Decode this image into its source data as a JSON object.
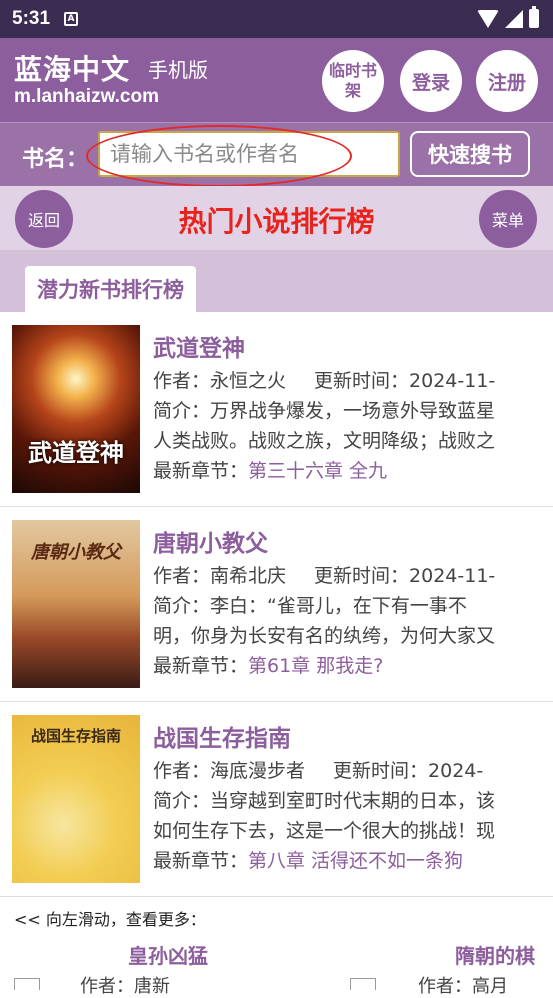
{
  "status_bar": {
    "time": "5:31",
    "notification_icon": "A"
  },
  "header": {
    "site_name": "蓝海中文",
    "site_sub": "手机版",
    "site_url": "m.lanhaizw.com",
    "buttons": {
      "bookshelf": "临时书架",
      "login": "登录",
      "register": "注册"
    }
  },
  "search": {
    "label": "书名：",
    "placeholder": "请输入书名或作者名",
    "button": "快速搜书"
  },
  "titlebar": {
    "back": "返回",
    "title": "热门小说排行榜",
    "menu": "菜单"
  },
  "tab": {
    "label": "潜力新书排行榜"
  },
  "books": [
    {
      "title": "武道登神",
      "cover_title": "武道登神",
      "author_label": "作者：",
      "author": "永恒之火",
      "update_label": "更新时间：",
      "update": "2024-11-",
      "intro_label": "简介：",
      "intro_1": "万界战争爆发，一场意外导致蓝星",
      "intro_2": "人类战败。战败之族，文明降级；战败之",
      "chapter_label": "最新章节：",
      "chapter": "第三十六章 全九"
    },
    {
      "title": "唐朝小教父",
      "cover_title": "唐朝小教父",
      "author_label": "作者：",
      "author": "南希北庆",
      "update_label": "更新时间：",
      "update": "2024-11-",
      "intro_label": "简介：",
      "intro_1": "李白：“雀哥儿，在下有一事不",
      "intro_2": "明，你身为长安有名的纨绔，为何大家又",
      "chapter_label": "最新章节：",
      "chapter": "第61章 那我走?"
    },
    {
      "title": "战国生存指南",
      "cover_title": "战国生存指南",
      "author_label": "作者：",
      "author": "海底漫步者",
      "update_label": "更新时间：",
      "update": "2024-",
      "intro_label": "简介：",
      "intro_1": "当穿越到室町时代末期的日本，该",
      "intro_2": "如何生存下去，这是一个很大的挑战！现",
      "chapter_label": "最新章节：",
      "chapter": "第八章 活得还不如一条狗"
    }
  ],
  "more": {
    "hint": "<< 向左滑动，查看更多：",
    "items": [
      {
        "title": "皇孙凶猛",
        "author_line": "作者：唐新"
      },
      {
        "title": "隋朝的棋",
        "author_line": "作者：高月"
      }
    ]
  }
}
